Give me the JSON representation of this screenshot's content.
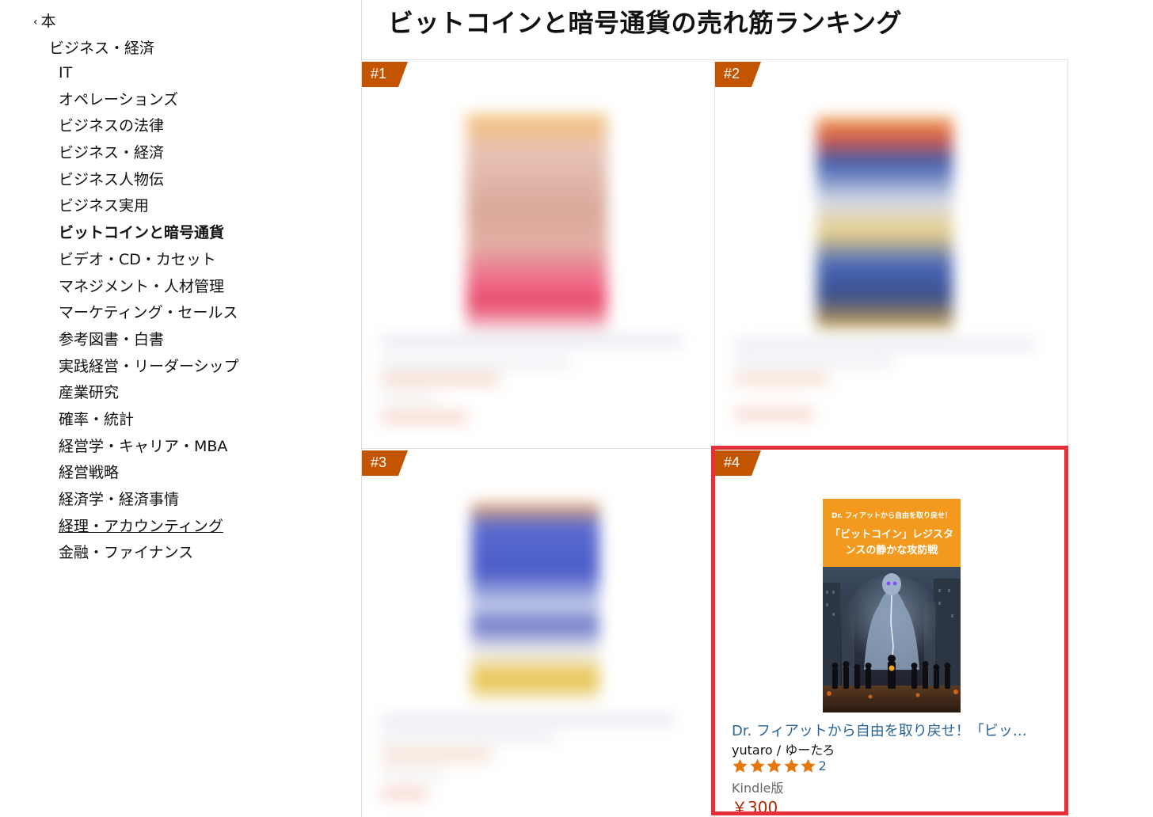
{
  "sidebar": {
    "back_label": "本",
    "parent_category": "ビジネス・経済",
    "categories": [
      "IT",
      "オペレーションズ",
      "ビジネスの法律",
      "ビジネス・経済",
      "ビジネス人物伝",
      "ビジネス実用",
      "ビットコインと暗号通貨",
      "ビデオ・CD・カセット",
      "マネジメント・人材管理",
      "マーケティング・セールス",
      "参考図書・白書",
      "実践経営・リーダーシップ",
      "産業研究",
      "確率・統計",
      "経営学・キャリア・MBA",
      "経営戦略",
      "経済学・経済事情",
      "経理・アカウンティング",
      "金融・ファイナンス"
    ],
    "current_category": "ビットコインと暗号通貨",
    "hovered_category": "経理・アカウンティング"
  },
  "main": {
    "title": "ビットコインと暗号通貨の売れ筋ランキング",
    "products": [
      {
        "rank": "#1"
      },
      {
        "rank": "#2"
      },
      {
        "rank": "#3"
      },
      {
        "rank": "#4",
        "cover_subtitle": "Dr. フィアットから自由を取り戻せ！",
        "cover_title_line1": "「ビットコイン」レジスタ",
        "cover_title_line2": "ンスの静かな攻防戦",
        "title": "Dr. フィアットから自由を取り戻せ！「ビッ…",
        "author": "yutaro / ゆーたろ",
        "rating": 5,
        "review_count": "2",
        "format": "Kindle版",
        "price": "￥300"
      }
    ]
  },
  "colors": {
    "badge": "#c45500",
    "highlight": "#e8303a",
    "link": "#2a6496",
    "star": "#e47911",
    "price": "#b12704",
    "cover_orange": "#f39a1e"
  },
  "icons": {
    "back": "chevron-left-icon",
    "star": "star-icon"
  }
}
